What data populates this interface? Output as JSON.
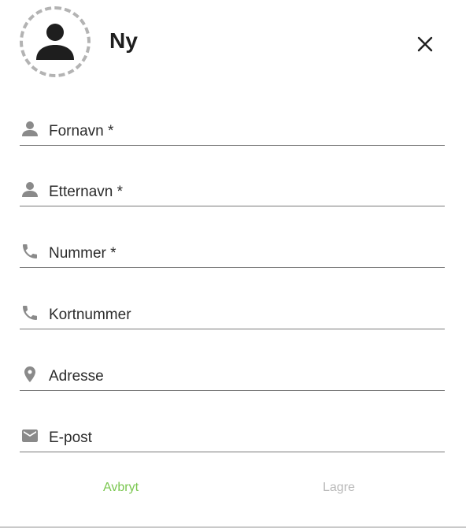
{
  "dialog": {
    "title": "Ny",
    "close_icon": "close-icon",
    "avatar_icon": "person-icon"
  },
  "fields": [
    {
      "label": "Fornavn *",
      "icon": "person-icon"
    },
    {
      "label": "Etternavn *",
      "icon": "person-icon"
    },
    {
      "label": "Nummer *",
      "icon": "phone-icon"
    },
    {
      "label": "Kortnummer",
      "icon": "phone-icon"
    },
    {
      "label": "Adresse",
      "icon": "location-pin-icon"
    },
    {
      "label": "E-post",
      "icon": "mail-icon"
    }
  ],
  "actions": {
    "cancel_label": "Avbryt",
    "save_label": "Lagre"
  },
  "colors": {
    "accent": "#7ac74f",
    "disabled": "#b8b8b8",
    "icon": "#8a8a8a"
  }
}
